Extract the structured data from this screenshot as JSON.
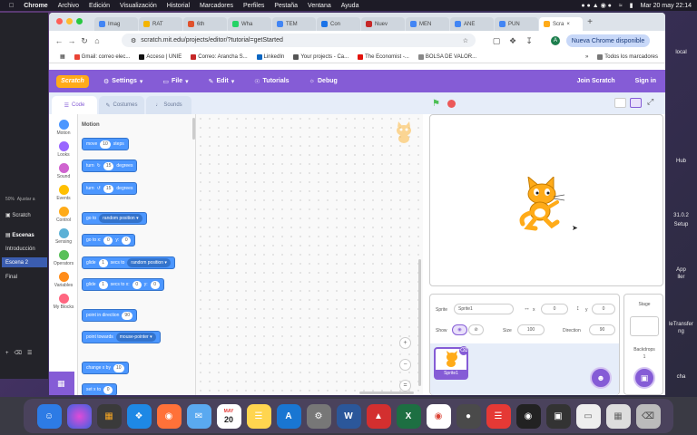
{
  "mac_menu": {
    "app": "Chrome",
    "items": [
      "Archivo",
      "Edición",
      "Visualización",
      "Historial",
      "Marcadores",
      "Perfiles",
      "Pestaña",
      "Ventana",
      "Ayuda"
    ],
    "clock": "Mar 20 may 22:14"
  },
  "obs": {
    "ratio_label": "50%",
    "adjust_label": "Ajustar a",
    "source": "Scratch",
    "scenes_title": "Escenas",
    "scenes": [
      "Introducción",
      "Escena 2",
      "Final"
    ],
    "selected_scene": "Escena 2"
  },
  "desktop_icons": [
    "local",
    "Hub",
    "31.0.2",
    "Setup",
    "App",
    "ller",
    "leTransfer",
    "ng",
    "cha"
  ],
  "tabs": [
    {
      "label": "Imag",
      "color": "#4285f4"
    },
    {
      "label": "RAT",
      "color": "#f4b400"
    },
    {
      "label": "6th",
      "color": "#e0522d"
    },
    {
      "label": "Wha",
      "color": "#25d366"
    },
    {
      "label": "TEM",
      "color": "#4285f4"
    },
    {
      "label": "Con",
      "color": "#1a73e8"
    },
    {
      "label": "Nuev",
      "color": "#c62828"
    },
    {
      "label": "MEN",
      "color": "#4285f4"
    },
    {
      "label": "ANE",
      "color": "#4285f4"
    },
    {
      "label": "PUN",
      "color": "#4285f4"
    },
    {
      "label": "Scra",
      "color": "#ffab19"
    }
  ],
  "url": "scratch.mit.edu/projects/editor/?tutorial=getStarted",
  "chrome_update": "Nueva Chrome disponible",
  "avatar_letter": "A",
  "bookmarks": [
    "Gmail: correo elec...",
    "Acceso | UNIE",
    "Correo: Arancha S...",
    "LinkedIn",
    "Your projects - Ca...",
    "The Economist -...",
    "BOLSA DE VALOR..."
  ],
  "all_bookmarks": "Todos los marcadores",
  "scratch": {
    "logo": "Scratch",
    "menu": {
      "settings": "Settings",
      "file": "File",
      "edit": "Edit",
      "tutorials": "Tutorials",
      "debug": "Debug",
      "join": "Join Scratch",
      "signin": "Sign in"
    },
    "tabs": {
      "code": "Code",
      "costumes": "Costumes",
      "sounds": "Sounds"
    },
    "categories": [
      {
        "label": "Motion",
        "color": "#4c97ff"
      },
      {
        "label": "Looks",
        "color": "#9966ff"
      },
      {
        "label": "Sound",
        "color": "#cf63cf"
      },
      {
        "label": "Events",
        "color": "#ffbf00"
      },
      {
        "label": "Control",
        "color": "#ffab19"
      },
      {
        "label": "Sensing",
        "color": "#5cb1d6"
      },
      {
        "label": "Operators",
        "color": "#59c059"
      },
      {
        "label": "Variables",
        "color": "#ff8c1a"
      },
      {
        "label": "My Blocks",
        "color": "#ff6680"
      }
    ],
    "palette_title": "Motion",
    "blocks": {
      "move": "move",
      "move_val": "10",
      "steps": "steps",
      "turn_r": "turn",
      "turn_r_val": "15",
      "degrees": "degrees",
      "turn_l": "turn",
      "turn_l_val": "15",
      "goto": "go to",
      "goto_dd": "random position",
      "gotoxy": "go to x:",
      "gotoxy_x": "0",
      "y": "y:",
      "gotoxy_y": "0",
      "glide": "glide",
      "glide_val": "1",
      "secs_to": "secs to",
      "glide_dd": "random position",
      "glide2": "glide",
      "glide2_val": "1",
      "secs_to_x": "secs to x:",
      "glide2_x": "0",
      "glide2_y": "0",
      "point": "point in direction",
      "point_val": "90",
      "towards": "point towards",
      "towards_dd": "mouse-pointer",
      "changex": "change x by",
      "changex_val": "10",
      "setx": "set x to",
      "setx_val": "0"
    },
    "sprite_info": {
      "sprite_label": "Sprite",
      "sprite_name": "Sprite1",
      "x_label": "x",
      "x_val": "0",
      "y_label": "y",
      "y_val": "0",
      "show_label": "Show",
      "size_label": "Size",
      "size_val": "100",
      "direction_label": "Direction",
      "direction_val": "90"
    },
    "sprite_thumb": "Sprite1",
    "stage_label": "Stage",
    "backdrops_label": "Backdrops",
    "backdrops_count": "1"
  },
  "dock_calendar": {
    "month": "MAY",
    "day": "20"
  }
}
